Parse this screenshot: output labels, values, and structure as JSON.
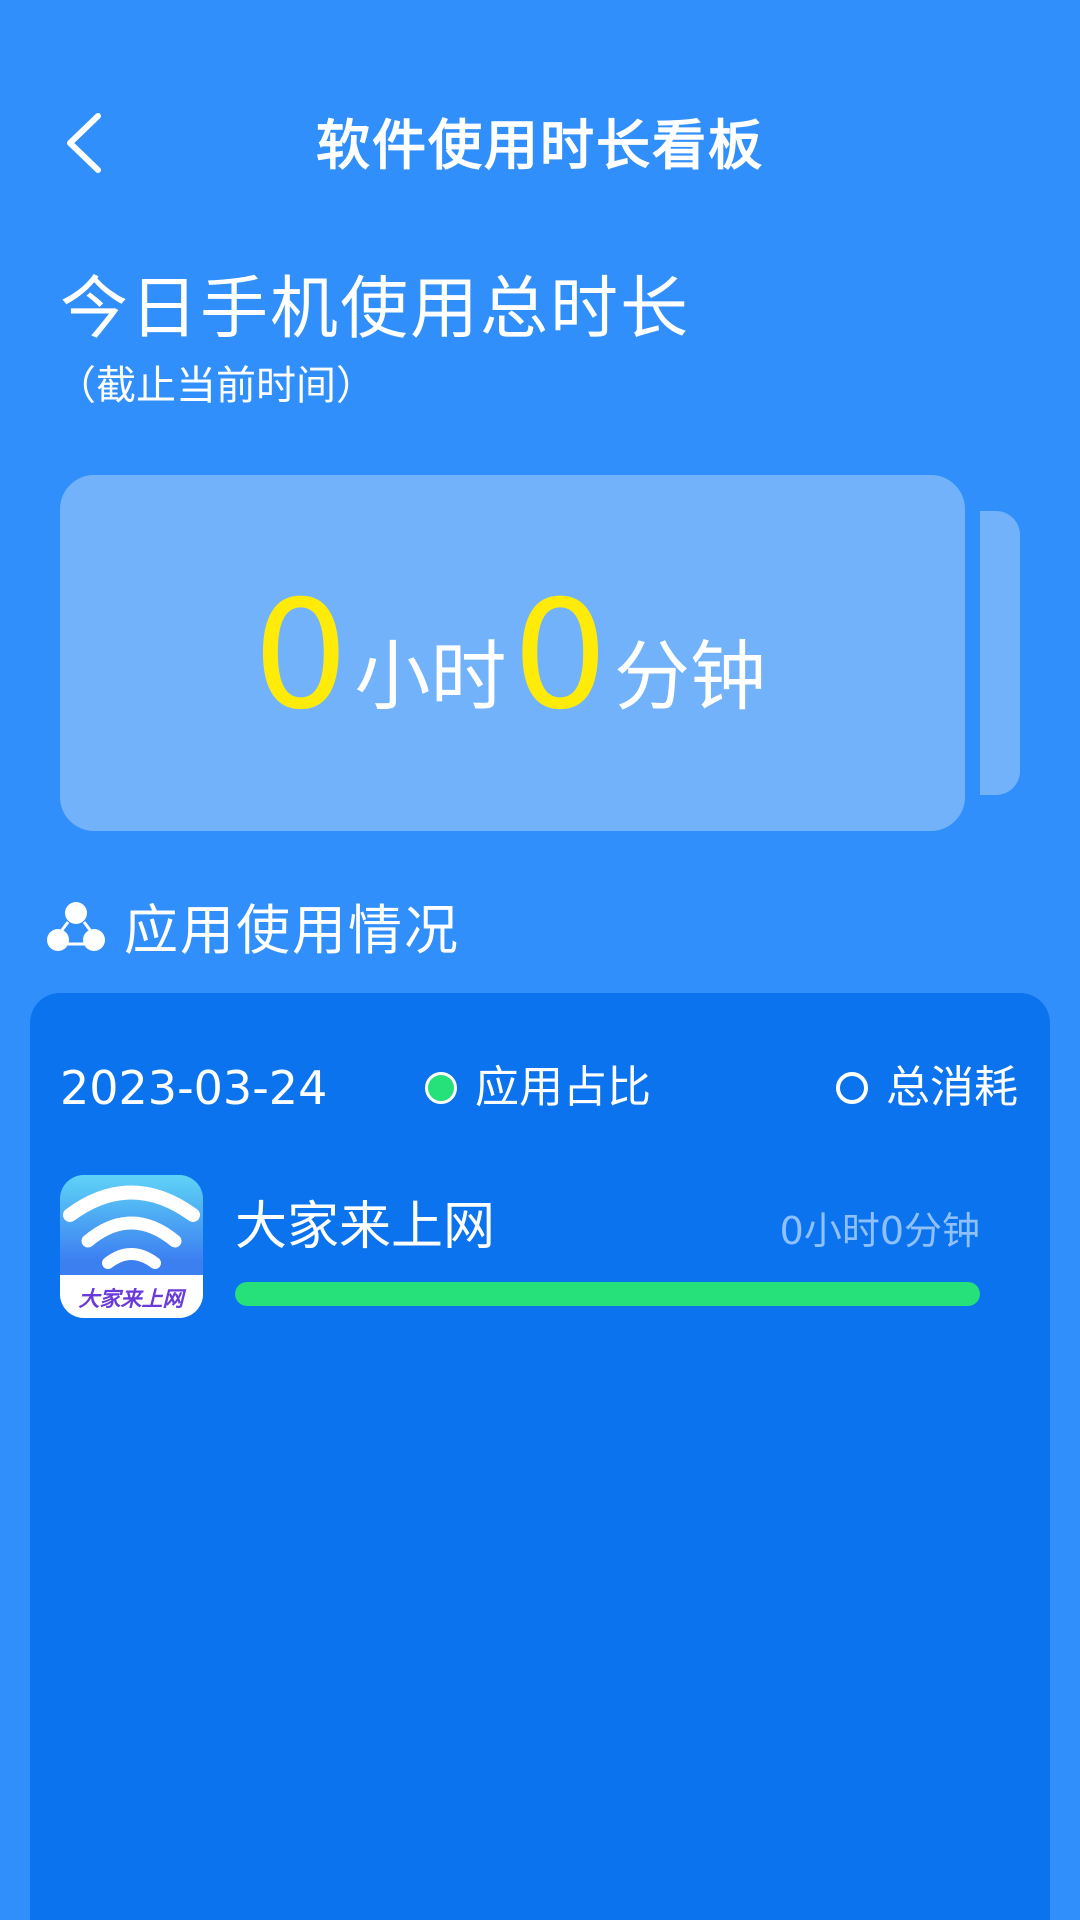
{
  "header": {
    "title": "软件使用时长看板"
  },
  "today": {
    "title": "今日手机使用总时长",
    "subtitle": "（截止当前时间）",
    "hours": "0",
    "hours_unit": "小时",
    "minutes": "0",
    "minutes_unit": "分钟"
  },
  "section": {
    "title": "应用使用情况"
  },
  "panel": {
    "date": "2023-03-24",
    "options": [
      {
        "label": "应用占比",
        "selected": true
      },
      {
        "label": "总消耗",
        "selected": false
      }
    ]
  },
  "apps": [
    {
      "name": "大家来上网",
      "time": "0小时0分钟",
      "icon_text": "大家来上网",
      "progress": 1.0
    }
  ],
  "colors": {
    "background": "#318ffc",
    "card": "#72b2fb",
    "panel": "#0b73ee",
    "highlight_number": "#ffeb0a",
    "progress": "#26e079"
  }
}
